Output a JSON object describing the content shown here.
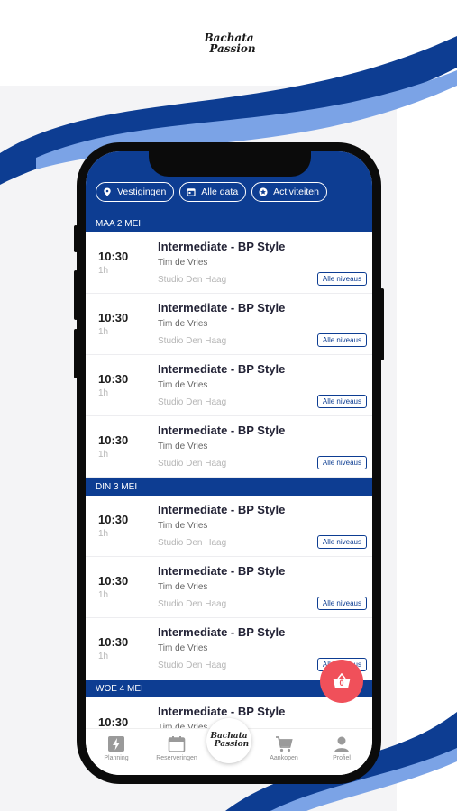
{
  "brand": {
    "logo_line1": "Bachata",
    "logo_line2": "Passion"
  },
  "filters": [
    {
      "label": "Vestigingen",
      "icon": "location-pin-icon"
    },
    {
      "label": "Alle data",
      "icon": "calendar-icon"
    },
    {
      "label": "Activiteiten",
      "icon": "star-icon"
    }
  ],
  "days": [
    {
      "label": "MAA 2 MEI"
    },
    {
      "label": "DIN 3 MEI"
    },
    {
      "label": "WOE 4 MEI"
    }
  ],
  "lessons": [
    {
      "time": "10:30",
      "duration": "1h",
      "title": "Intermediate - BP Style",
      "teacher": "Tim de Vries",
      "studio": "Studio Den Haag",
      "level": "Alle niveaus"
    },
    {
      "time": "10:30",
      "duration": "1h",
      "title": "Intermediate - BP Style",
      "teacher": "Tim de Vries",
      "studio": "Studio Den Haag",
      "level": "Alle niveaus"
    },
    {
      "time": "10:30",
      "duration": "1h",
      "title": "Intermediate - BP Style",
      "teacher": "Tim de Vries",
      "studio": "Studio Den Haag",
      "level": "Alle niveaus"
    },
    {
      "time": "10:30",
      "duration": "1h",
      "title": "Intermediate - BP Style",
      "teacher": "Tim de Vries",
      "studio": "Studio Den Haag",
      "level": "Alle niveaus"
    },
    {
      "time": "10:30",
      "duration": "1h",
      "title": "Intermediate - BP Style",
      "teacher": "Tim de Vries",
      "studio": "Studio Den Haag",
      "level": "Alle niveaus"
    },
    {
      "time": "10:30",
      "duration": "1h",
      "title": "Intermediate - BP Style",
      "teacher": "Tim de Vries",
      "studio": "Studio Den Haag",
      "level": "Alle niveaus"
    },
    {
      "time": "10:30",
      "duration": "1h",
      "title": "Intermediate - BP Style",
      "teacher": "Tim de Vries",
      "studio": "Studio Den Haag",
      "level": "Alle niveaus"
    },
    {
      "time": "10:30",
      "duration": "",
      "title": "Intermediate - BP Style",
      "teacher": "Tim de Vries",
      "studio": "",
      "level": ""
    }
  ],
  "cart": {
    "count": "0",
    "icon": "basket-icon"
  },
  "tabs": [
    {
      "label": "Planning",
      "icon": "lightning-icon"
    },
    {
      "label": "Reserveringen",
      "icon": "calendar-icon"
    },
    {
      "label": "Aankopen",
      "icon": "cart-icon"
    },
    {
      "label": "Profiel",
      "icon": "person-icon"
    }
  ],
  "colors": {
    "primary": "#0d3d92",
    "wave_light": "#7ba3e6",
    "accent": "#f0505a"
  }
}
